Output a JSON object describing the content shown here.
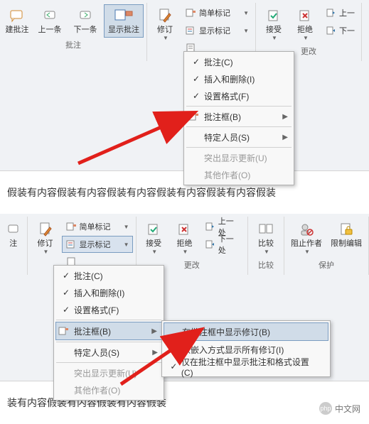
{
  "top": {
    "toolbar": {
      "comments_group_label": "批注",
      "changes_group_label": "更改",
      "create_comment": "建批注",
      "prev_comment": "上一条",
      "next_comment": "下一条",
      "show_comments": "显示批注",
      "revise": "修订",
      "simple_markup": "简单标记",
      "show_markup": "显示标记",
      "accept": "接受",
      "reject": "拒绝",
      "prev_change": "上一",
      "next_change": "下一"
    },
    "menu": {
      "comments": "批注(C)",
      "ins_del": "插入和删除(I)",
      "format": "设置格式(F)",
      "balloons": "批注框(B)",
      "people": "特定人员(S)",
      "highlight": "突出显示更新(U)",
      "others": "其他作者(O)"
    },
    "body_text": "假装有内容假装有内容假装有内容假装有内容假装有内容假装"
  },
  "bottom": {
    "toolbar": {
      "changes_group_label": "更改",
      "compare_group_label": "比较",
      "protect_group_label": "保护",
      "comment": "注",
      "revise": "修订",
      "simple_markup": "简单标记",
      "show_markup": "显示标记",
      "accept": "接受",
      "reject": "拒绝",
      "prev_change": "上一处",
      "next_change": "下一处",
      "compare": "比较",
      "block_authors": "阻止作者",
      "restrict_edit": "限制编辑"
    },
    "menu": {
      "comments": "批注(C)",
      "ins_del": "插入和删除(I)",
      "format": "设置格式(F)",
      "balloons": "批注框(B)",
      "people": "特定人员(S)",
      "highlight": "突出显示更新(U)",
      "others": "其他作者(O)"
    },
    "submenu": {
      "show_rev": "在批注框中显示修订(B)",
      "inline": "以嵌入方式显示所有修订(I)",
      "only_fmt": "仅在批注框中显示批注和格式设置(C)"
    },
    "body_text": "装有内容假装有内容假装有内容假装"
  },
  "logo": {
    "brand": "php",
    "text": "中文网"
  }
}
